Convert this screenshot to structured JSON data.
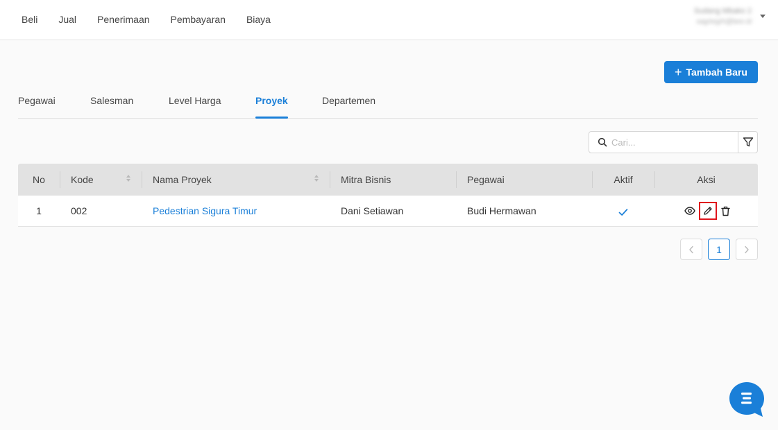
{
  "nav": {
    "items": [
      "Beli",
      "Jual",
      "Penerimaan",
      "Pembayaran",
      "Biaya"
    ]
  },
  "user": {
    "name": "Sudang Mbako 2",
    "email": "sagrtegrh@bee.id"
  },
  "actions": {
    "add_label": "Tambah Baru"
  },
  "tabs": [
    "Pegawai",
    "Salesman",
    "Level Harga",
    "Proyek",
    "Departemen"
  ],
  "active_tab": "Proyek",
  "search": {
    "placeholder": "Cari..."
  },
  "table": {
    "headers": [
      "No",
      "Kode",
      "Nama Proyek",
      "Mitra Bisnis",
      "Pegawai",
      "Aktif",
      "Aksi"
    ],
    "rows": [
      {
        "no": "1",
        "kode": "002",
        "nama": "Pedestrian Sigura Timur",
        "mitra": "Dani Setiawan",
        "pegawai": "Budi Hermawan",
        "aktif": true
      }
    ]
  },
  "pagination": {
    "current": "1"
  },
  "colors": {
    "accent": "#1a7fd8",
    "highlight": "#e0141c"
  },
  "icons": [
    "search-icon",
    "filter-icon",
    "eye-icon",
    "pencil-icon",
    "trash-icon",
    "check-icon",
    "chevron-left-icon",
    "chevron-right-icon",
    "chat-icon"
  ]
}
